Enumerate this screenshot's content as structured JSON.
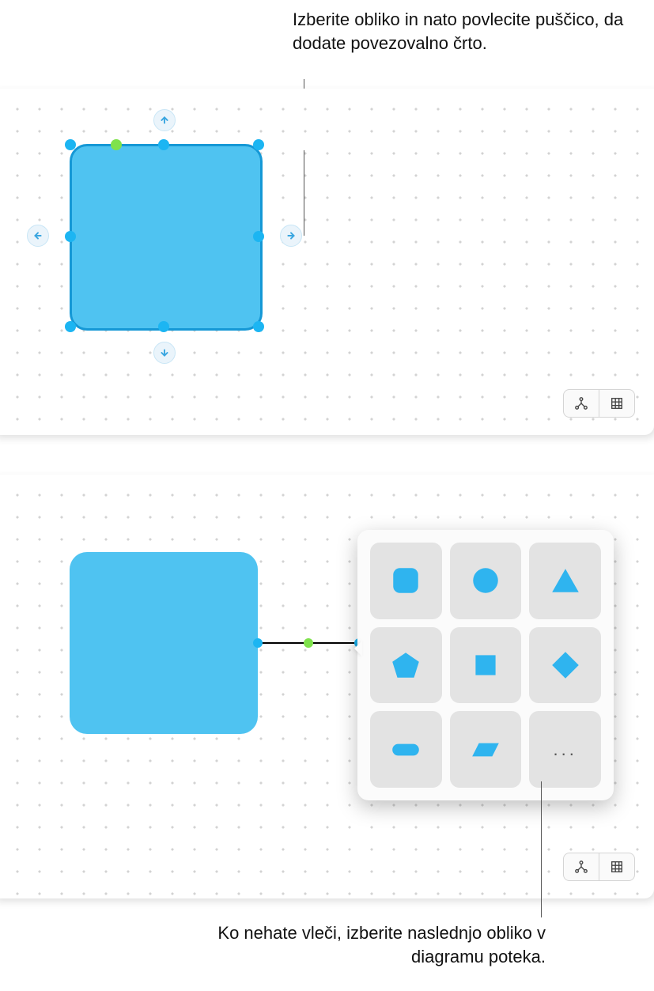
{
  "callouts": {
    "top": "Izberite obliko in nato povlecite puščico, da dodate povezovalno črto.",
    "bottom": "Ko nehate vleči, izberite naslednjo obliko v diagramu poteka."
  },
  "shape_picker": {
    "options": [
      "rounded-square",
      "circle",
      "triangle",
      "pentagon",
      "square",
      "diamond",
      "pill",
      "parallelogram",
      "more"
    ],
    "more_glyph": "..."
  },
  "toolbar": {
    "connect_tool": "connect",
    "grid_tool": "grid"
  },
  "colors": {
    "shape_fill": "#4fc3f1",
    "shape_border": "#1598d6",
    "handle": "#1cb5f2",
    "rotation_handle": "#7fe24c"
  }
}
